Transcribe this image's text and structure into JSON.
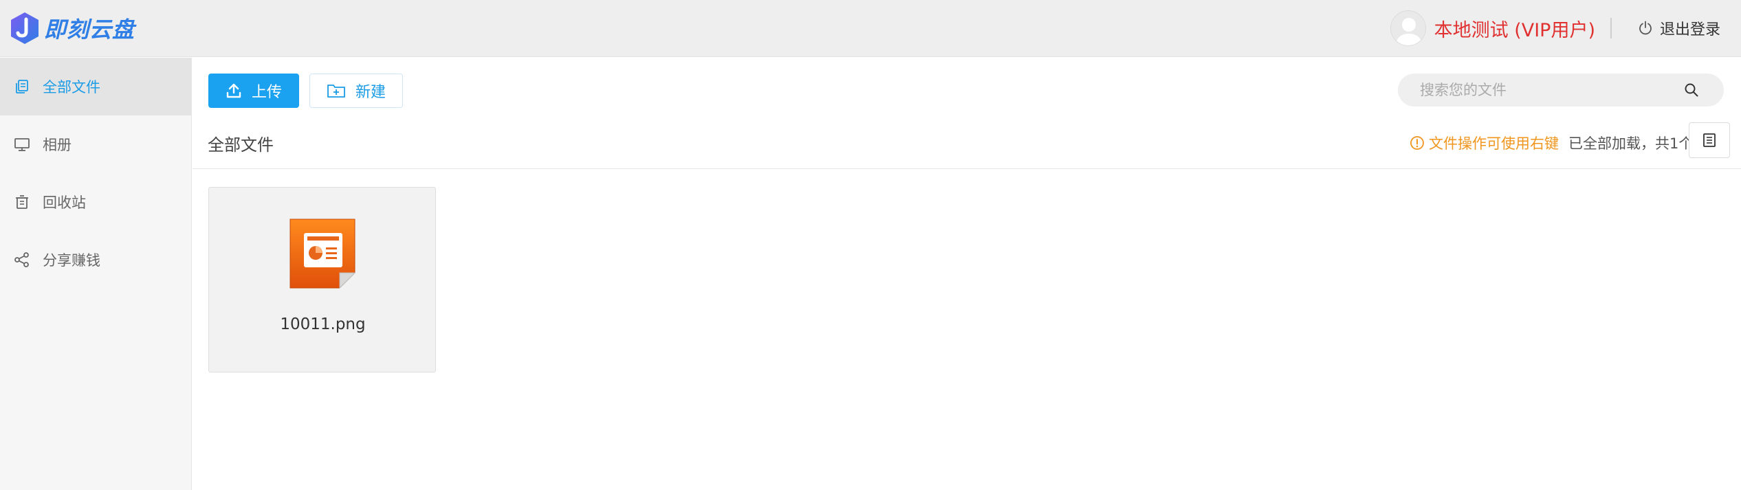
{
  "app": {
    "logo_text": "即刻云盘"
  },
  "header": {
    "username": "本地测试 (VIP用户)",
    "logout_label": "退出登录"
  },
  "sidebar": {
    "items": [
      {
        "label": "全部文件",
        "icon": "files-icon",
        "active": true
      },
      {
        "label": "相册",
        "icon": "monitor-icon",
        "active": false
      },
      {
        "label": "回收站",
        "icon": "trash-icon",
        "active": false
      },
      {
        "label": "分享赚钱",
        "icon": "share-icon",
        "active": false
      }
    ]
  },
  "toolbar": {
    "upload_label": "上传",
    "new_label": "新建"
  },
  "search": {
    "placeholder": "搜索您的文件"
  },
  "content": {
    "breadcrumb": "全部文件",
    "hint_text": "文件操作可使用右键",
    "load_status": "已全部加载，共1个"
  },
  "files": [
    {
      "name": "10011.png",
      "icon": "presentation-file-icon"
    }
  ],
  "colors": {
    "accent": "#1aa2f0",
    "username": "#e03030",
    "warning": "#f0961e"
  }
}
